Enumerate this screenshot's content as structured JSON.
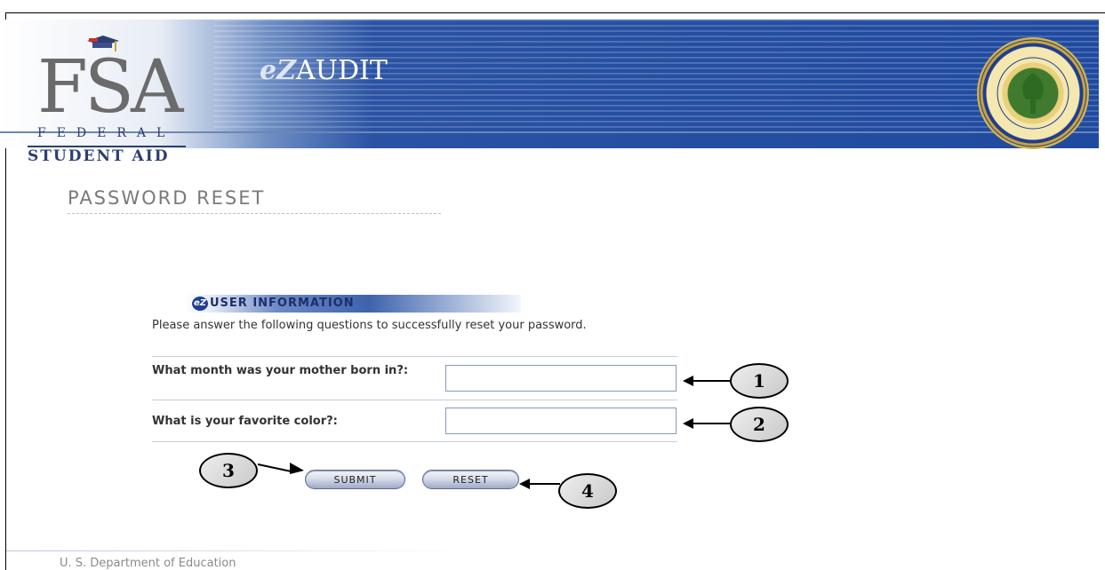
{
  "header": {
    "logo_letters": "FSA",
    "logo_federal": "FEDERAL",
    "logo_student_aid": "STUDENT AID",
    "app_prefix": "eZ",
    "app_name": "AUDIT",
    "seal_text": "DEPARTMENT OF EDUCATION · UNITED STATES OF AMERICA"
  },
  "page": {
    "title": "PASSWORD RESET"
  },
  "section": {
    "icon_glyph": "eZ",
    "title": "USER INFORMATION",
    "intro": "Please answer the following questions to successfully reset your password."
  },
  "questions": [
    {
      "label": "What month was your mother born in?:",
      "value": ""
    },
    {
      "label": "What is your favorite color?:",
      "value": ""
    }
  ],
  "buttons": {
    "submit": "SUBMIT",
    "reset": "RESET"
  },
  "callouts": [
    "1",
    "2",
    "3",
    "4"
  ],
  "footer": {
    "text": "U. S. Department of Education"
  }
}
